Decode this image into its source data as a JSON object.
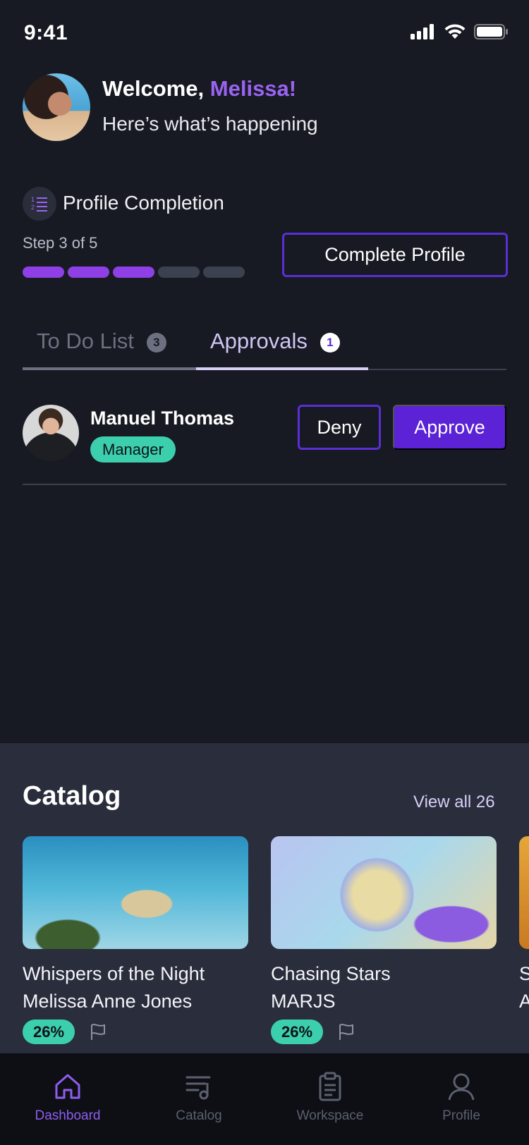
{
  "status_bar": {
    "time": "9:41"
  },
  "header": {
    "welcome_prefix": "Welcome,",
    "user_name": "Melissa!",
    "subtitle": "Here’s what’s happening"
  },
  "profile_completion": {
    "title": "Profile Completion",
    "step_text": "Step 3 of 5",
    "steps_completed": 3,
    "steps_total": 5,
    "button_label": "Complete Profile"
  },
  "tabs": [
    {
      "label": "To Do List",
      "count": "3",
      "active": false
    },
    {
      "label": "Approvals",
      "count": "1",
      "active": true
    }
  ],
  "approvals": [
    {
      "name": "Manuel Thomas",
      "role": "Manager",
      "deny_label": "Deny",
      "approve_label": "Approve"
    }
  ],
  "catalog": {
    "title": "Catalog",
    "view_all_label": "View all 26",
    "items": [
      {
        "title": "Whispers of the Night",
        "artist": "Melissa Anne Jones",
        "progress": "26%"
      },
      {
        "title": "Chasing Stars",
        "artist": "MARJS",
        "progress": "26%"
      },
      {
        "title": "S",
        "artist": "A",
        "progress": ""
      }
    ]
  },
  "bottom_nav": [
    {
      "label": "Dashboard",
      "icon": "home-icon",
      "active": true
    },
    {
      "label": "Catalog",
      "icon": "music-list-icon",
      "active": false
    },
    {
      "label": "Workspace",
      "icon": "clipboard-icon",
      "active": false
    },
    {
      "label": "Profile",
      "icon": "user-icon",
      "active": false
    }
  ],
  "colors": {
    "background": "#171a22",
    "accent_purple": "#5b22d6",
    "highlight_purple": "#9a63f2",
    "teal_badge": "#3ccfae",
    "panel": "#292d3c"
  }
}
